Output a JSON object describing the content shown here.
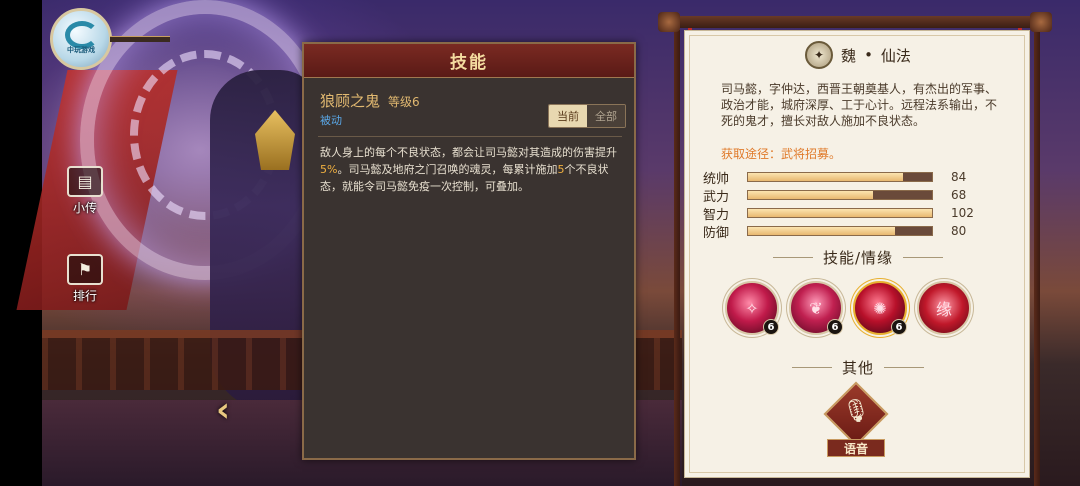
{
  "logo": {
    "text": "中玩游戏"
  },
  "side_nav": [
    {
      "label": "小传",
      "icon": "biography-cards-icon"
    },
    {
      "label": "排行",
      "icon": "ranking-flags-icon"
    }
  ],
  "skill_popup": {
    "title": "技能",
    "skill_name": "狼顾之鬼",
    "skill_level": "等级6",
    "skill_type": "被动",
    "toggle": {
      "current": "当前",
      "all": "全部"
    },
    "desc_part1": "敌人身上的每个不良状态，都会让司马懿对其造成的伤害提升",
    "desc_highlight1": "5%",
    "desc_part2": "。司马懿及地府之门召唤的魂灵，每累计施加",
    "desc_highlight2": "5",
    "desc_part3": "个不良状态，就能令司马懿免疫一次控制，可叠加。"
  },
  "hero_info": {
    "faction": "魏",
    "separator": "•",
    "class": "仙法",
    "bio": "司马懿，字仲达，西晋王朝奠基人，有杰出的军事、政治才能，城府深厚、工于心计。远程法系输出，不死的鬼才，擅长对敌人施加不良状态。",
    "acquire": "获取途径：武将招募。",
    "stats": [
      {
        "label": "统帅",
        "value": "84",
        "fill": 0.84
      },
      {
        "label": "武力",
        "value": "68",
        "fill": 0.68
      },
      {
        "label": "智力",
        "value": "102",
        "fill": 1.0
      },
      {
        "label": "防御",
        "value": "80",
        "fill": 0.8
      }
    ],
    "skills_heading": "技能/情缘",
    "skills": [
      {
        "icon": "skill-ghost-icon",
        "level": "6"
      },
      {
        "icon": "skill-soul-icon",
        "level": "6"
      },
      {
        "icon": "skill-wolf-icon",
        "level": "6"
      },
      {
        "icon": "bond-yuan-icon",
        "glyph": "缘"
      }
    ],
    "other_heading": "其他",
    "voice_label": "语音"
  },
  "colors": {
    "popup_bg": "#3a3330",
    "popup_header": "#7a2a22",
    "skill_name": "#e0b870",
    "skill_type": "#5aa8e8",
    "highlight": "#f0b040",
    "panel_bg": "#f6f1e6",
    "acquire": "#e07a2a"
  }
}
